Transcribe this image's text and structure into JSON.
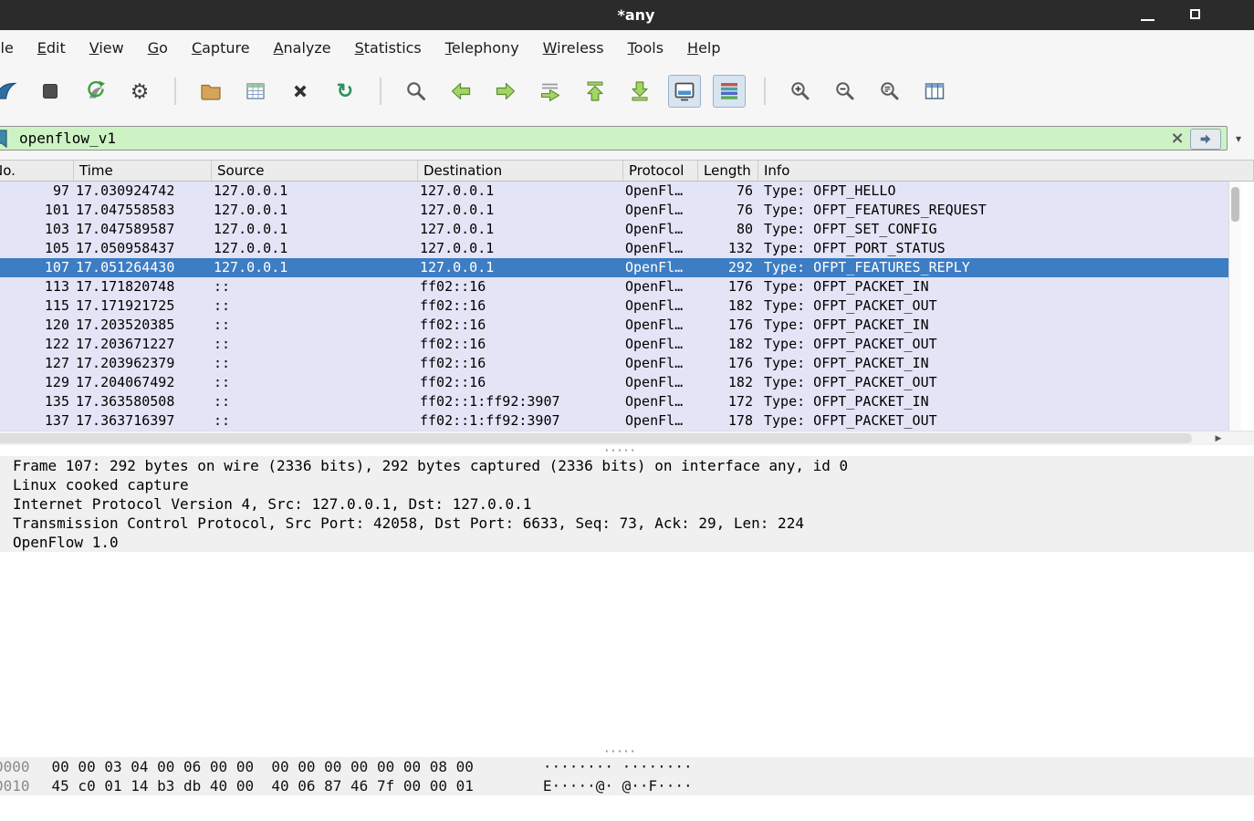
{
  "icons": {
    "gear": "⚙",
    "reload": "↻",
    "caret_down": "▾",
    "clear_filter": "×",
    "scroll_right_arrow": "▶",
    "splitter_dots": "·····"
  },
  "colors": {
    "titlebar_bg": "#2b2b2b",
    "filter_valid_bg": "#cdf3c5",
    "packet_row_bg": "#e4e4f7",
    "selected_row_bg": "#3c7dc4",
    "selected_row_text": "#ffffff"
  },
  "titlebar": {
    "title": "*any"
  },
  "menubar": {
    "items": [
      "File",
      "Edit",
      "View",
      "Go",
      "Capture",
      "Analyze",
      "Statistics",
      "Telephony",
      "Wireless",
      "Tools",
      "Help"
    ]
  },
  "toolbar": {
    "buttons": [
      "start-capture",
      "stop-capture",
      "restart-capture",
      "capture-options",
      "open-capture-file",
      "save-capture-file",
      "close-capture-file",
      "reload-capture",
      "find-packet",
      "go-back",
      "go-forward",
      "go-to-packet",
      "go-to-first-packet",
      "go-to-last-packet",
      "auto-scroll-toggle",
      "colorize-packets-toggle",
      "zoom-in",
      "zoom-out",
      "zoom-normal",
      "resize-columns"
    ]
  },
  "filter": {
    "value": "openflow_v1"
  },
  "packet_list": {
    "columns": [
      "No.",
      "Time",
      "Source",
      "Destination",
      "Protocol",
      "Length",
      "Info"
    ],
    "rows": [
      {
        "no": "97",
        "time": "17.030924742",
        "source": "127.0.0.1",
        "destination": "127.0.0.1",
        "protocol": "OpenFl…",
        "length": "76",
        "info": "Type: OFPT_HELLO",
        "selected": false
      },
      {
        "no": "101",
        "time": "17.047558583",
        "source": "127.0.0.1",
        "destination": "127.0.0.1",
        "protocol": "OpenFl…",
        "length": "76",
        "info": "Type: OFPT_FEATURES_REQUEST",
        "selected": false
      },
      {
        "no": "103",
        "time": "17.047589587",
        "source": "127.0.0.1",
        "destination": "127.0.0.1",
        "protocol": "OpenFl…",
        "length": "80",
        "info": "Type: OFPT_SET_CONFIG",
        "selected": false
      },
      {
        "no": "105",
        "time": "17.050958437",
        "source": "127.0.0.1",
        "destination": "127.0.0.1",
        "protocol": "OpenFl…",
        "length": "132",
        "info": "Type: OFPT_PORT_STATUS",
        "selected": false
      },
      {
        "no": "107",
        "time": "17.051264430",
        "source": "127.0.0.1",
        "destination": "127.0.0.1",
        "protocol": "OpenFl…",
        "length": "292",
        "info": "Type: OFPT_FEATURES_REPLY",
        "selected": true
      },
      {
        "no": "113",
        "time": "17.171820748",
        "source": "::",
        "destination": "ff02::16",
        "protocol": "OpenFl…",
        "length": "176",
        "info": "Type: OFPT_PACKET_IN",
        "selected": false
      },
      {
        "no": "115",
        "time": "17.171921725",
        "source": "::",
        "destination": "ff02::16",
        "protocol": "OpenFl…",
        "length": "182",
        "info": "Type: OFPT_PACKET_OUT",
        "selected": false
      },
      {
        "no": "120",
        "time": "17.203520385",
        "source": "::",
        "destination": "ff02::16",
        "protocol": "OpenFl…",
        "length": "176",
        "info": "Type: OFPT_PACKET_IN",
        "selected": false
      },
      {
        "no": "122",
        "time": "17.203671227",
        "source": "::",
        "destination": "ff02::16",
        "protocol": "OpenFl…",
        "length": "182",
        "info": "Type: OFPT_PACKET_OUT",
        "selected": false
      },
      {
        "no": "127",
        "time": "17.203962379",
        "source": "::",
        "destination": "ff02::16",
        "protocol": "OpenFl…",
        "length": "176",
        "info": "Type: OFPT_PACKET_IN",
        "selected": false
      },
      {
        "no": "129",
        "time": "17.204067492",
        "source": "::",
        "destination": "ff02::16",
        "protocol": "OpenFl…",
        "length": "182",
        "info": "Type: OFPT_PACKET_OUT",
        "selected": false
      },
      {
        "no": "135",
        "time": "17.363580508",
        "source": "::",
        "destination": "ff02::1:ff92:3907",
        "protocol": "OpenFl…",
        "length": "172",
        "info": "Type: OFPT_PACKET_IN",
        "selected": false
      },
      {
        "no": "137",
        "time": "17.363716397",
        "source": "::",
        "destination": "ff02::1:ff92:3907",
        "protocol": "OpenFl…",
        "length": "178",
        "info": "Type: OFPT_PACKET_OUT",
        "selected": false
      }
    ]
  },
  "details": {
    "lines": [
      "Frame 107: 292 bytes on wire (2336 bits), 292 bytes captured (2336 bits) on interface any, id 0",
      "Linux cooked capture",
      "Internet Protocol Version 4, Src: 127.0.0.1, Dst: 127.0.0.1",
      "Transmission Control Protocol, Src Port: 42058, Dst Port: 6633, Seq: 73, Ack: 29, Len: 224",
      "OpenFlow 1.0"
    ]
  },
  "bytes": {
    "rows": [
      {
        "offset": "0000",
        "hex": "00 00 03 04 00 06 00 00  00 00 00 00 00 00 08 00",
        "ascii": "········ ········"
      },
      {
        "offset": "0010",
        "hex": "45 c0 01 14 b3 db 40 00  40 06 87 46 7f 00 00 01",
        "ascii": "E·····@· @··F····"
      }
    ]
  }
}
